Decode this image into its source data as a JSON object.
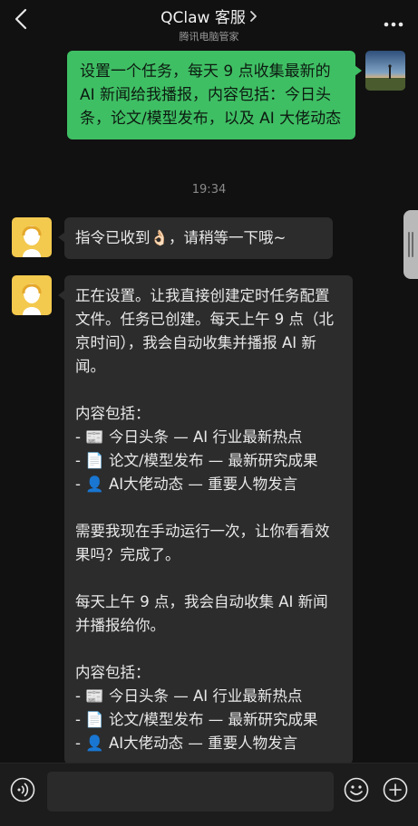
{
  "header": {
    "title": "QClaw 客服",
    "subtitle": "腾讯电脑管家",
    "back_icon": "chevron-left-icon",
    "more_icon": "more-dots-icon"
  },
  "messages": [
    {
      "direction": "outgoing",
      "text": "设置一个任务，每天 9 点收集最新的 AI 新闻给我播报，内容包括：今日头条，论文/模型发布，以及 AI 大佬动态"
    },
    {
      "direction": "time",
      "text": "19:34"
    },
    {
      "direction": "incoming",
      "text": "指令已收到👌🏻，请稍等一下哦~"
    },
    {
      "direction": "incoming",
      "text": "正在设置。让我直接创建定时任务配置文件。任务已创建。每天上午 9 点（北京时间），我会自动收集并播报 AI 新闻。\n\n内容包括：\n- 📰 今日头条 — AI 行业最新热点\n- 📄 论文/模型发布 — 最新研究成果\n- 👤 AI大佬动态 — 重要人物发言\n\n需要我现在手动运行一次，让你看看效果吗？完成了。\n\n每天上午 9 点，我会自动收集 AI 新闻并播报给你。\n\n内容包括：\n- 📰 今日头条 — AI 行业最新热点\n- 📄 论文/模型发布 — 最新研究成果\n- 👤 AI大佬动态 — 重要人物发言"
    }
  ],
  "input": {
    "placeholder": "",
    "value": ""
  },
  "colors": {
    "background": "#111111",
    "outgoing_bubble": "#3fbf64",
    "incoming_bubble": "#2c2c2c",
    "input_bar": "#1c1c1c"
  }
}
